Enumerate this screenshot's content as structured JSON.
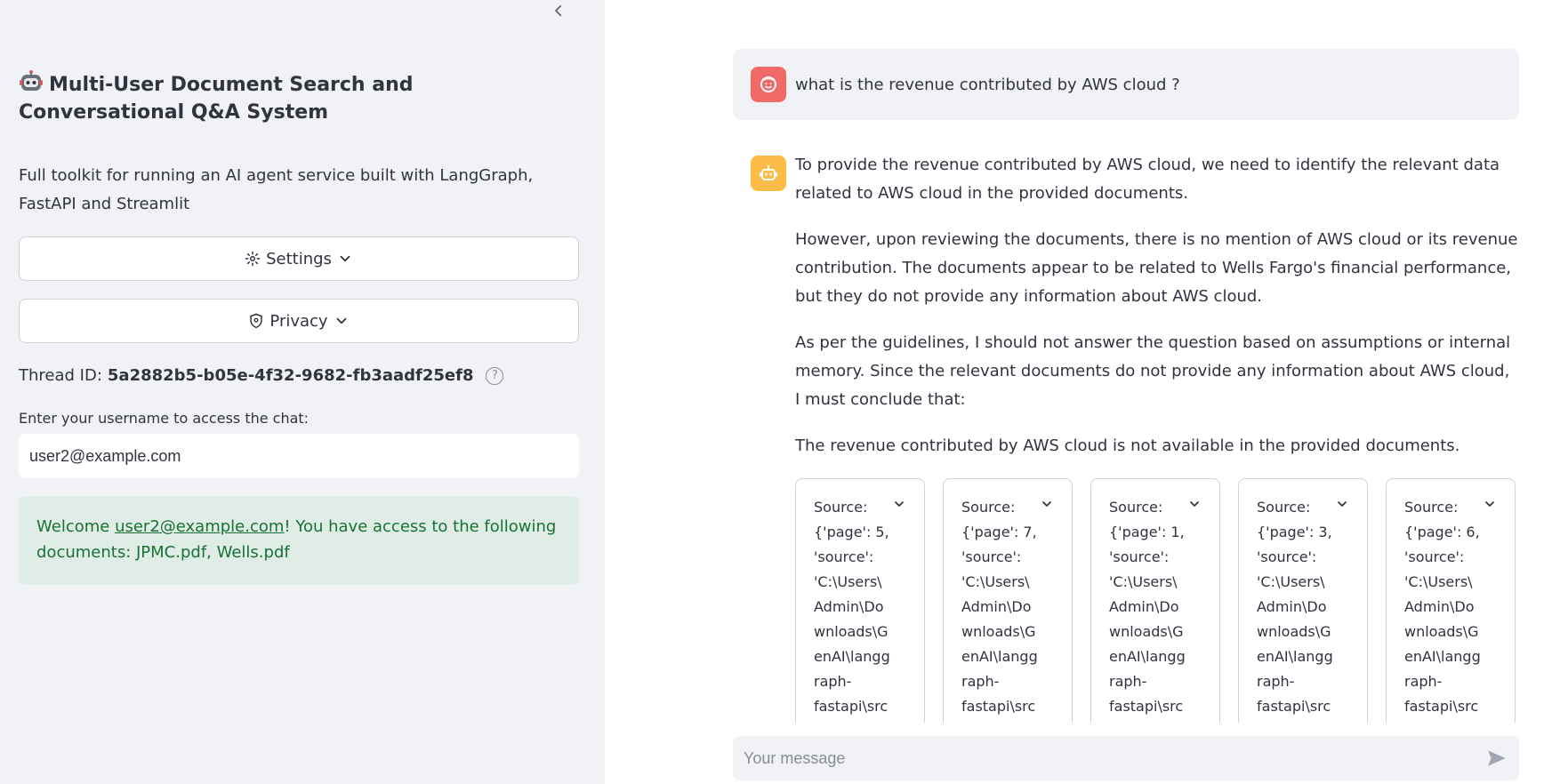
{
  "sidebar": {
    "collapse_icon": "chevron-left-icon",
    "title": "Multi-User Document Search and Conversational Q&A System",
    "title_icon": "robot-face-icon",
    "description": "Full toolkit for running an AI agent service built with LangGraph, FastAPI and Streamlit",
    "settings_label": "Settings",
    "privacy_label": "Privacy",
    "thread_label": "Thread ID:",
    "thread_id": "5a2882b5-b05e-4f32-9682-fb3aadf25ef8",
    "username_label": "Enter your username to access the chat:",
    "username_value": "user2@example.com",
    "alert": {
      "prefix": "Welcome ",
      "user_link": "user2@example.com",
      "suffix": "! You have access to the following documents: JPMC.pdf, Wells.pdf"
    }
  },
  "chat": {
    "user_message": "what is the revenue contributed by AWS cloud ?",
    "bot_paragraphs": [
      "To provide the revenue contributed by AWS cloud, we need to identify the relevant data related to AWS cloud in the provided documents.",
      "However, upon reviewing the documents, there is no mention of AWS cloud or its revenue contribution. The documents appear to be related to Wells Fargo's financial performance, but they do not provide any information about AWS cloud.",
      "As per the guidelines, I should not answer the question based on assumptions or internal memory. Since the relevant documents do not provide any information about AWS cloud, I must conclude that:",
      "The revenue contributed by AWS cloud is not available in the provided documents."
    ],
    "sources": [
      "Source:\n{'page': 5,\n'source':\n'C:\\Users\\\nAdmin\\Do\nwnloads\\G\nenAI\\langg\nraph-\nfastapi\\src",
      "Source:\n{'page': 7,\n'source':\n'C:\\Users\\\nAdmin\\Do\nwnloads\\G\nenAI\\langg\nraph-\nfastapi\\src",
      "Source:\n{'page': 1,\n'source':\n'C:\\Users\\\nAdmin\\Do\nwnloads\\G\nenAI\\langg\nraph-\nfastapi\\src",
      "Source:\n{'page': 3,\n'source':\n'C:\\Users\\\nAdmin\\Do\nwnloads\\G\nenAI\\langg\nraph-\nfastapi\\src",
      "Source:\n{'page': 6,\n'source':\n'C:\\Users\\\nAdmin\\Do\nwnloads\\G\nenAI\\langg\nraph-\nfastapi\\src"
    ],
    "input_placeholder": "Your message"
  },
  "colors": {
    "sidebar_bg": "#f0f2f6",
    "user_avatar": "#f06a6a",
    "bot_avatar": "#fbbd47",
    "alert_bg": "#dfede6",
    "alert_text": "#177233"
  }
}
